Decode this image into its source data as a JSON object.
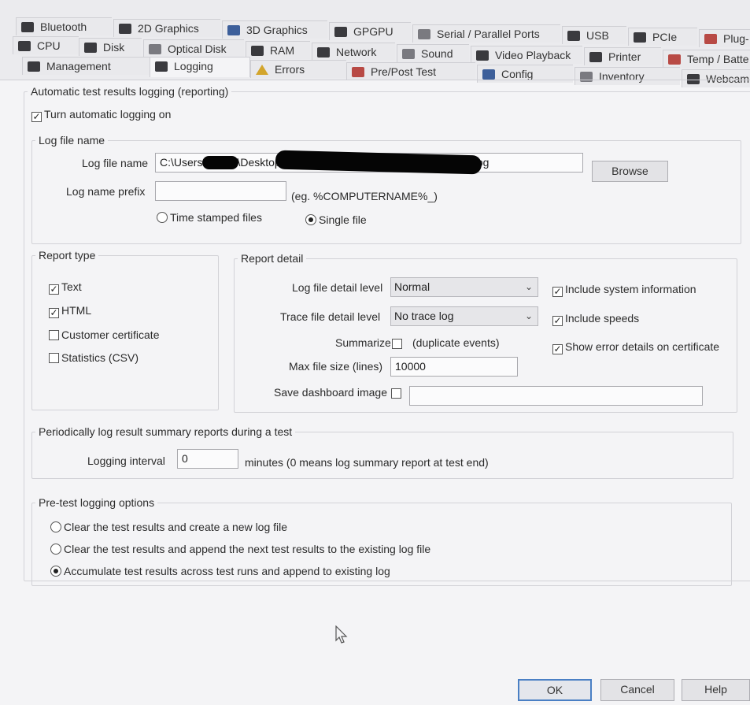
{
  "tabs": {
    "row1": [
      {
        "label": "Bluetooth",
        "icon": "bluetooth-icon"
      },
      {
        "label": "2D Graphics",
        "icon": "monitor-icon"
      },
      {
        "label": "3D Graphics",
        "icon": "cubes-icon"
      },
      {
        "label": "GPGPU",
        "icon": "chip-icon"
      },
      {
        "label": "Serial / Parallel Ports",
        "icon": "cable-icon"
      },
      {
        "label": "USB",
        "icon": "usb-icon"
      },
      {
        "label": "PCIe",
        "icon": "pcie-card-icon"
      },
      {
        "label": "Plug-",
        "icon": "plug-icon"
      }
    ],
    "row2": [
      {
        "label": "CPU",
        "icon": "cpu-icon"
      },
      {
        "label": "Disk",
        "icon": "disk-icon"
      },
      {
        "label": "Optical Disk",
        "icon": "optical-disc-icon"
      },
      {
        "label": "RAM",
        "icon": "ram-icon"
      },
      {
        "label": "Network",
        "icon": "network-icon"
      },
      {
        "label": "Sound",
        "icon": "speaker-icon"
      },
      {
        "label": "Video Playback",
        "icon": "film-icon"
      },
      {
        "label": "Printer",
        "icon": "printer-icon"
      },
      {
        "label": "Temp / Batte",
        "icon": "thermometer-icon"
      }
    ],
    "row3": [
      {
        "label": "Management",
        "icon": "management-icon"
      },
      {
        "label": "Logging",
        "icon": "logging-icon"
      },
      {
        "label": "Errors",
        "icon": "warning-icon"
      },
      {
        "label": "Pre/Post Test",
        "icon": "pre-post-test-icon"
      },
      {
        "label": "Config",
        "icon": "config-gear-icon"
      },
      {
        "label": "Inventory",
        "icon": "inventory-icon"
      },
      {
        "label": "Webcam",
        "icon": "webcam-icon"
      }
    ],
    "active": "Logging"
  },
  "auto_logging": {
    "group_title": "Automatic test results logging (reporting)",
    "turn_on_label": "Turn automatic logging on",
    "turn_on_checked": true
  },
  "log_file": {
    "group_title": "Log file name",
    "name_label": "Log file name",
    "name_value_prefix": "C:\\Users",
    "name_value_middle": "\\Desktop",
    "name_value_suffix": "log",
    "browse_label": "Browse",
    "prefix_label": "Log name prefix",
    "prefix_value": "",
    "prefix_hint": "(eg. %COMPUTERNAME%_)",
    "time_stamped_label": "Time stamped files",
    "single_file_label": "Single file",
    "selected": "Single file"
  },
  "report_type": {
    "group_title": "Report type",
    "items": [
      {
        "label": "Text",
        "checked": true
      },
      {
        "label": "HTML",
        "checked": true
      },
      {
        "label": "Customer certificate",
        "checked": false
      },
      {
        "label": "Statistics (CSV)",
        "checked": false
      }
    ]
  },
  "report_detail": {
    "group_title": "Report detail",
    "log_level_label": "Log file detail level",
    "log_level_value": "Normal",
    "trace_level_label": "Trace file detail level",
    "trace_level_value": "No trace log",
    "summarize_label": "Summarize",
    "summarize_hint": "(duplicate events)",
    "summarize_checked": false,
    "max_size_label": "Max file size (lines)",
    "max_size_value": "10000",
    "dashboard_label": "Save dashboard image",
    "dashboard_checked": false,
    "dashboard_value": "",
    "include_sysinfo_label": "Include system information",
    "include_sysinfo_checked": true,
    "include_speeds_label": "Include speeds",
    "include_speeds_checked": true,
    "show_errors_label": "Show error details on certificate",
    "show_errors_checked": true
  },
  "periodic": {
    "group_title": "Periodically log result summary reports during a test",
    "interval_label": "Logging interval",
    "interval_value": "0",
    "interval_hint": "minutes (0 means log summary report at test end)"
  },
  "pretest": {
    "group_title": "Pre-test logging options",
    "options": [
      {
        "label": "Clear the test results and create a new log file",
        "selected": false
      },
      {
        "label": "Clear the test results and append the next test results to the existing log file",
        "selected": false
      },
      {
        "label": "Accumulate test results across test runs and append to existing log",
        "selected": true
      }
    ]
  },
  "footer": {
    "ok_label": "OK",
    "cancel_label": "Cancel",
    "help_label": "Help"
  }
}
